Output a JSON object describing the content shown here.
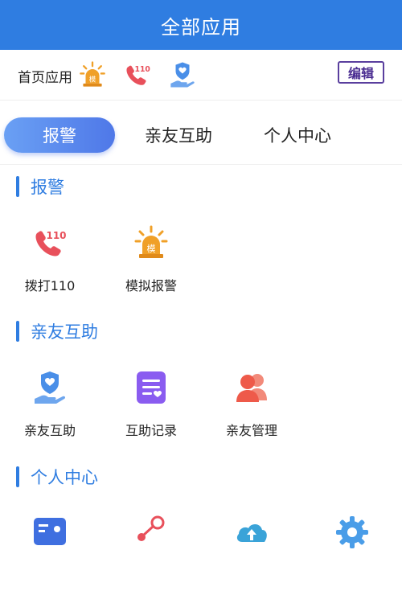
{
  "header": {
    "title": "全部应用"
  },
  "quick": {
    "label": "首页应用",
    "edit_label": "编辑",
    "icons": [
      "siren-icon",
      "phone-110-icon",
      "shield-hand-icon"
    ]
  },
  "tabs": [
    {
      "label": "报警",
      "active": true
    },
    {
      "label": "亲友互助",
      "active": false
    },
    {
      "label": "个人中心",
      "active": false
    }
  ],
  "sections": [
    {
      "title": "报警",
      "apps": [
        {
          "name": "拨打110",
          "icon": "phone-110-icon"
        },
        {
          "name": "模拟报警",
          "icon": "siren-icon"
        }
      ]
    },
    {
      "title": "亲友互助",
      "apps": [
        {
          "name": "亲友互助",
          "icon": "shield-hand-icon"
        },
        {
          "name": "互助记录",
          "icon": "record-list-icon"
        },
        {
          "name": "亲友管理",
          "icon": "contacts-icon"
        }
      ]
    },
    {
      "title": "个人中心",
      "apps": [
        {
          "name": "",
          "icon": "id-card-icon"
        },
        {
          "name": "",
          "icon": "share-icon"
        },
        {
          "name": "",
          "icon": "cloud-upload-icon"
        },
        {
          "name": "",
          "icon": "settings-gear-icon"
        }
      ]
    }
  ],
  "icon_text": {
    "siren": "模",
    "phone": "110"
  },
  "colors": {
    "primary": "#2f7de1",
    "tab_active_start": "#6aa0f4",
    "tab_active_end": "#4f78e8",
    "edit_border": "#5a3f9e",
    "phone_red": "#e8505b",
    "siren_orange": "#f0a028",
    "purple": "#8a5cf0",
    "contacts_red": "#ee5a4a"
  }
}
